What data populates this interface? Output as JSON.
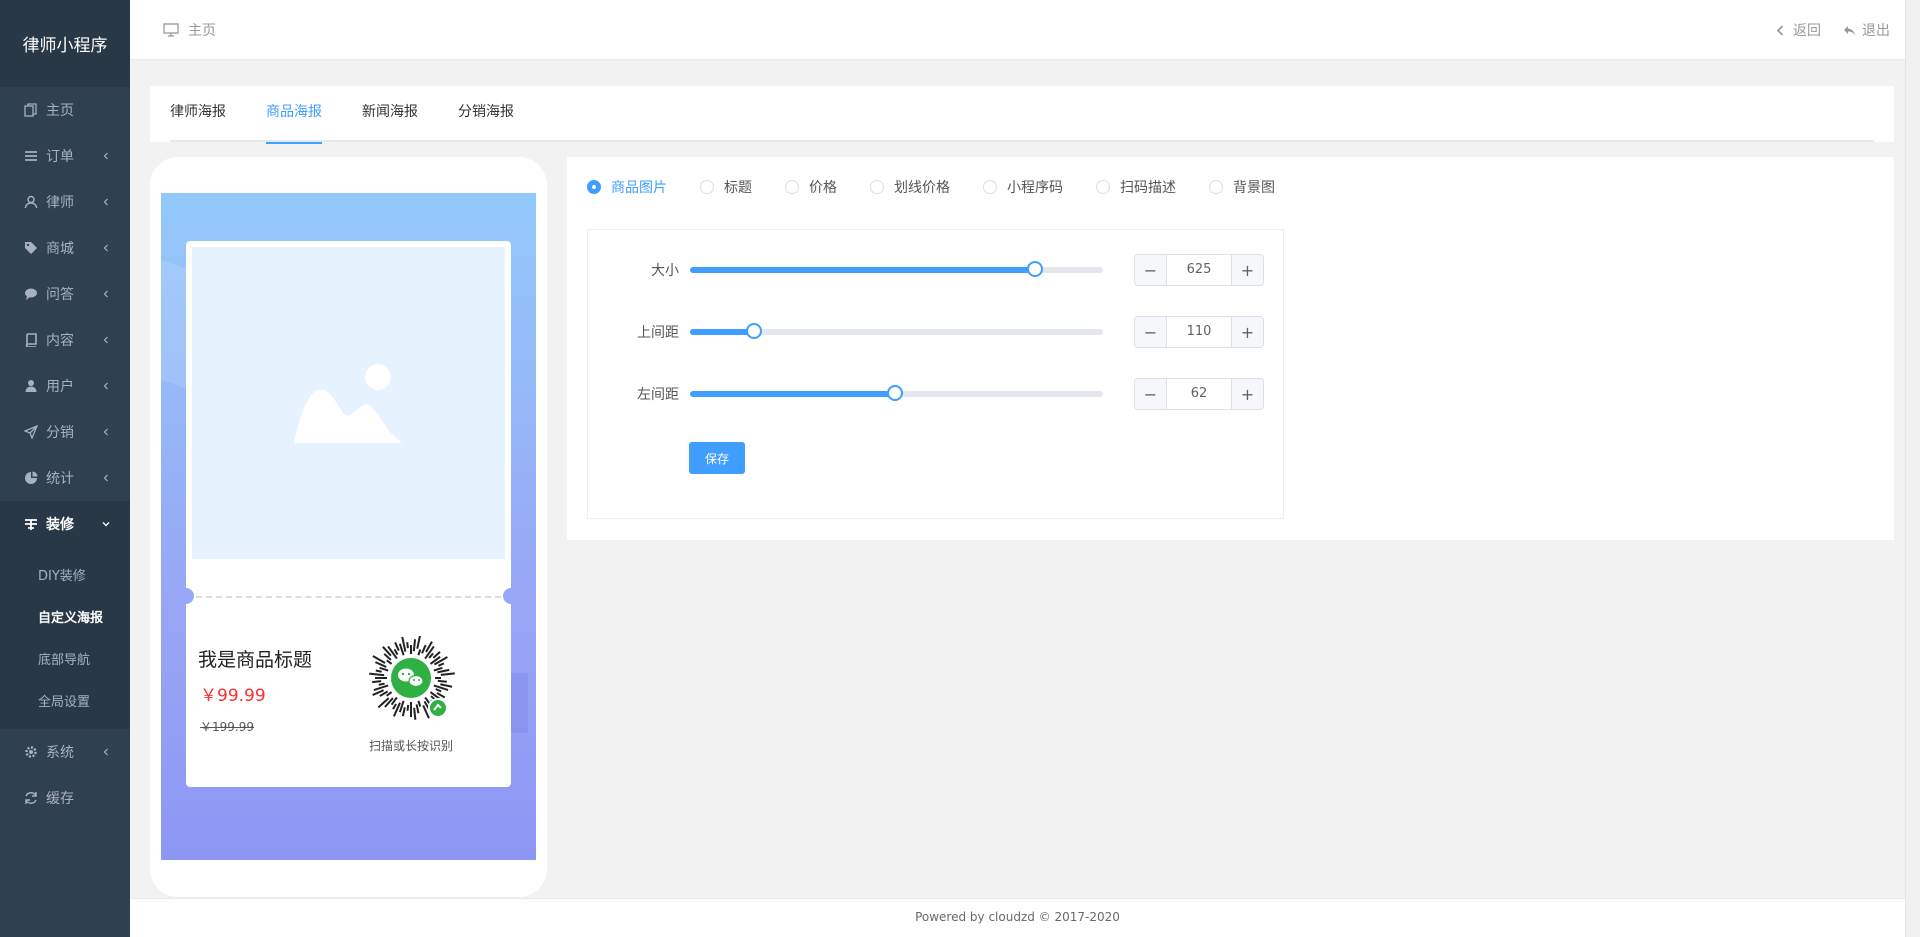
{
  "sidebar": {
    "brand": "律师小程序",
    "items": [
      {
        "label": "主页",
        "icon": "copy-icon"
      },
      {
        "label": "订单",
        "icon": "list-icon"
      },
      {
        "label": "律师",
        "icon": "user-icon"
      },
      {
        "label": "商城",
        "icon": "tags-icon"
      },
      {
        "label": "问答",
        "icon": "comment-icon"
      },
      {
        "label": "内容",
        "icon": "book-icon"
      },
      {
        "label": "用户",
        "icon": "user-icon"
      },
      {
        "label": "分销",
        "icon": "send-icon"
      },
      {
        "label": "统计",
        "icon": "pie-icon"
      },
      {
        "label": "装修",
        "icon": "paint-icon"
      },
      {
        "label": "系统",
        "icon": "gear-icon"
      },
      {
        "label": "缓存",
        "icon": "refresh-icon"
      }
    ],
    "submenu": [
      {
        "label": "DIY装修"
      },
      {
        "label": "自定义海报"
      },
      {
        "label": "底部导航"
      },
      {
        "label": "全局设置"
      }
    ]
  },
  "topbar": {
    "home": "主页",
    "back": "返回",
    "logout": "退出"
  },
  "tabs": [
    {
      "label": "律师海报"
    },
    {
      "label": "商品海报"
    },
    {
      "label": "新闻海报"
    },
    {
      "label": "分销海报"
    }
  ],
  "poster": {
    "title": "我是商品标题",
    "price": "￥99.99",
    "original_price": "￥199.99",
    "qr_desc": "扫描或长按识别"
  },
  "elements": [
    {
      "label": "商品图片"
    },
    {
      "label": "标题"
    },
    {
      "label": "价格"
    },
    {
      "label": "划线价格"
    },
    {
      "label": "小程序码"
    },
    {
      "label": "扫码描述"
    },
    {
      "label": "背景图"
    }
  ],
  "settings": {
    "size": {
      "label": "大小",
      "value": "625",
      "level": 0.835
    },
    "top": {
      "label": "上间距",
      "value": "110",
      "level": 0.155
    },
    "left": {
      "label": "左间距",
      "value": "62",
      "level": 0.497
    },
    "save": "保存"
  },
  "footer": "Powered by cloudzd © 2017-2020",
  "colors": {
    "accent": "#409eff",
    "sidebar": "#2f4050",
    "price": "#ff2e2e"
  }
}
